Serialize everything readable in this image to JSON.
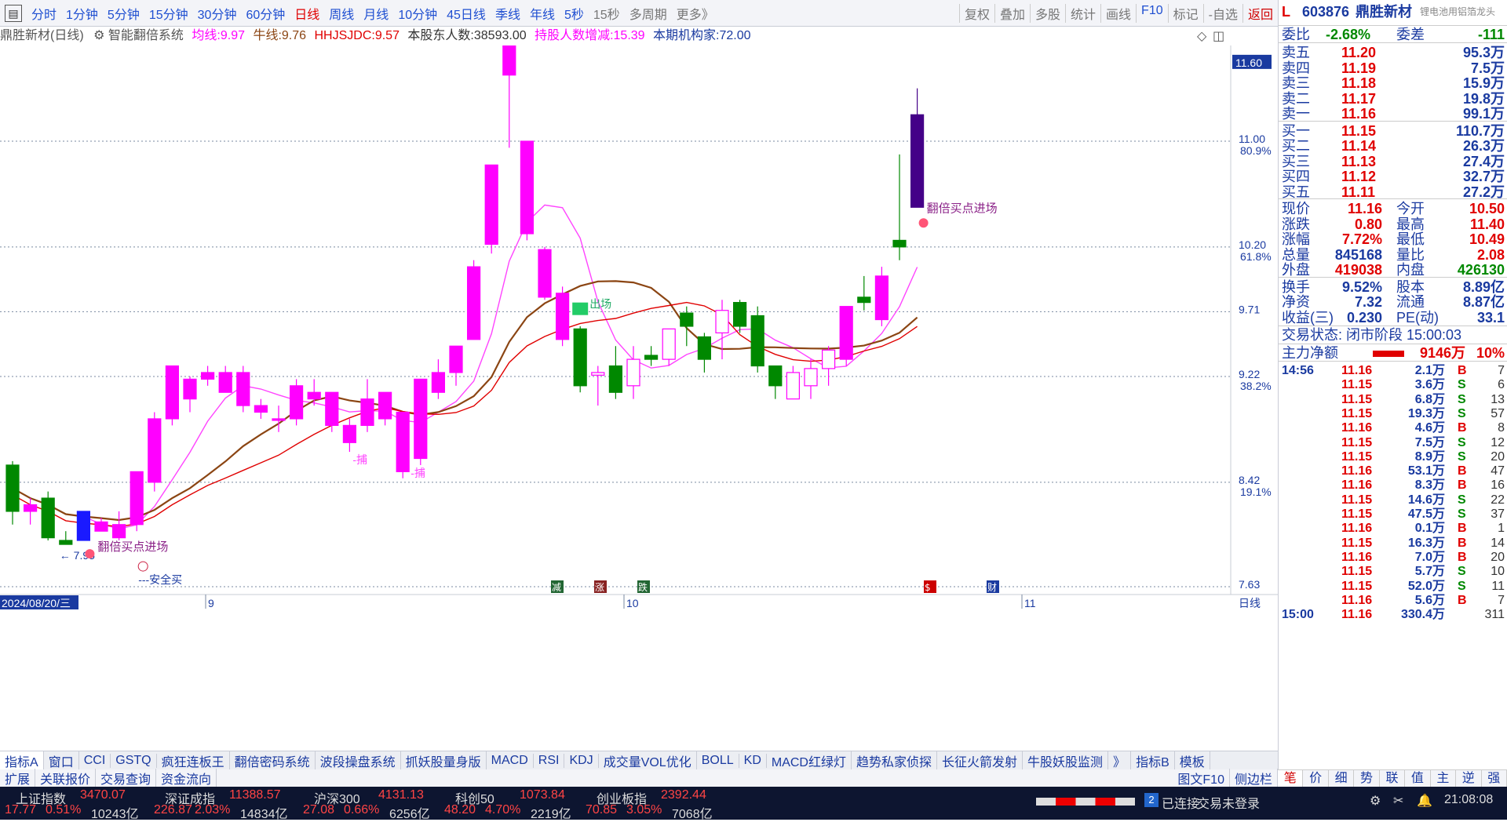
{
  "periods": [
    "分时",
    "1分钟",
    "5分钟",
    "15分钟",
    "30分钟",
    "60分钟",
    "日线",
    "周线",
    "月线",
    "10分钟",
    "45日线",
    "季线",
    "年线",
    "5秒",
    "15秒",
    "多周期",
    "更多》"
  ],
  "active_period": "日线",
  "tools": [
    "复权",
    "叠加",
    "多股",
    "统计",
    "画线",
    "F10",
    "标记",
    "-自选",
    "返回"
  ],
  "indicator_row": {
    "stock": "鼎胜新材(日线)",
    "system": "智能翻倍系统",
    "junxian_label": "均线:",
    "junxian": "9.97",
    "niuxian_label": "牛线:",
    "niuxian": "9.76",
    "hhjs_label": "HHJSJDC:",
    "hhjs": "9.57",
    "holders_label": "本股东人数:",
    "holders": "38593.00",
    "holders_chg_label": "持股人数增减:",
    "holders_chg": "15.39",
    "inst_label": "本期机构家:",
    "inst": "72.00"
  },
  "y_axis": {
    "ticks": [
      {
        "price": "11.60",
        "pct": ""
      },
      {
        "price": "11.00",
        "pct": "80.9%"
      },
      {
        "price": "10.20",
        "pct": "61.8%"
      },
      {
        "price": "9.71",
        "pct": ""
      },
      {
        "price": "9.22",
        "pct": "38.2%"
      },
      {
        "price": "8.42",
        "pct": "19.1%"
      },
      {
        "price": "7.63",
        "pct": ""
      }
    ],
    "highlight": "11.60"
  },
  "chart_data": {
    "type": "candlestick",
    "price_range": [
      7.6,
      11.9
    ],
    "candles": [
      {
        "o": 8.2,
        "c": 8.55,
        "h": 8.58,
        "l": 8.1,
        "up": false
      },
      {
        "o": 8.2,
        "c": 8.25,
        "h": 8.3,
        "l": 8.1,
        "up": true
      },
      {
        "o": 8.3,
        "c": 8.0,
        "h": 8.35,
        "l": 7.98,
        "up": false
      },
      {
        "o": 7.95,
        "c": 7.98,
        "h": 8.05,
        "l": 7.95,
        "up": false
      },
      {
        "o": 7.98,
        "c": 8.2,
        "h": 8.2,
        "l": 7.98,
        "up": false,
        "blue": true
      },
      {
        "o": 8.05,
        "c": 8.12,
        "h": 8.15,
        "l": 8.05,
        "up": true
      },
      {
        "o": 8.1,
        "c": 8.0,
        "h": 8.2,
        "l": 7.98,
        "up": true
      },
      {
        "o": 8.1,
        "c": 8.5,
        "h": 8.5,
        "l": 8.05,
        "up": true
      },
      {
        "o": 8.42,
        "c": 8.9,
        "h": 8.95,
        "l": 8.35,
        "up": true
      },
      {
        "o": 8.9,
        "c": 9.3,
        "h": 9.3,
        "l": 8.85,
        "up": true
      },
      {
        "o": 9.05,
        "c": 9.2,
        "h": 9.22,
        "l": 8.95,
        "up": true
      },
      {
        "o": 9.2,
        "c": 9.25,
        "h": 9.3,
        "l": 9.15,
        "up": true
      },
      {
        "o": 9.1,
        "c": 9.25,
        "h": 9.3,
        "l": 9.1,
        "up": true
      },
      {
        "o": 9.25,
        "c": 9.0,
        "h": 9.3,
        "l": 8.95,
        "up": false,
        "pink": true
      },
      {
        "o": 9.0,
        "c": 8.95,
        "h": 9.05,
        "l": 8.9,
        "up": true
      },
      {
        "o": 8.9,
        "c": 8.9,
        "h": 9.0,
        "l": 8.8,
        "up": true
      },
      {
        "o": 8.9,
        "c": 9.15,
        "h": 9.2,
        "l": 8.85,
        "up": true
      },
      {
        "o": 9.05,
        "c": 9.1,
        "h": 9.2,
        "l": 9.0,
        "up": true
      },
      {
        "o": 9.1,
        "c": 8.85,
        "h": 9.1,
        "l": 8.8,
        "up": false,
        "pink": true
      },
      {
        "o": 8.85,
        "c": 8.72,
        "h": 8.9,
        "l": 8.65,
        "up": false,
        "pink": true
      },
      {
        "o": 8.85,
        "c": 9.05,
        "h": 9.2,
        "l": 8.8,
        "up": true
      },
      {
        "o": 8.9,
        "c": 9.1,
        "h": 9.1,
        "l": 8.85,
        "up": true
      },
      {
        "o": 8.95,
        "c": 8.5,
        "h": 8.95,
        "l": 8.45,
        "up": false,
        "pink": true
      },
      {
        "o": 8.6,
        "c": 9.2,
        "h": 9.2,
        "l": 8.55,
        "up": true
      },
      {
        "o": 9.1,
        "c": 9.25,
        "h": 9.35,
        "l": 9.05,
        "up": true
      },
      {
        "o": 9.25,
        "c": 9.45,
        "h": 9.45,
        "l": 9.15,
        "up": true
      },
      {
        "o": 9.5,
        "c": 10.05,
        "h": 10.1,
        "l": 9.5,
        "up": true
      },
      {
        "o": 10.22,
        "c": 10.82,
        "h": 10.82,
        "l": 10.15,
        "up": true
      },
      {
        "o": 11.5,
        "c": 11.78,
        "h": 11.78,
        "l": 10.95,
        "up": true
      },
      {
        "o": 10.3,
        "c": 11.0,
        "h": 11.0,
        "l": 10.25,
        "up": true
      },
      {
        "o": 10.18,
        "c": 9.82,
        "h": 10.2,
        "l": 9.8,
        "up": false,
        "pink": true
      },
      {
        "o": 9.85,
        "c": 9.5,
        "h": 9.9,
        "l": 9.45,
        "up": false,
        "pink": true
      },
      {
        "o": 9.58,
        "c": 9.15,
        "h": 9.6,
        "l": 9.1,
        "up": false
      },
      {
        "o": 9.25,
        "c": 9.23,
        "h": 9.3,
        "l": 9.0,
        "up": true
      },
      {
        "o": 9.3,
        "c": 9.1,
        "h": 9.45,
        "l": 9.05,
        "up": false
      },
      {
        "o": 9.35,
        "c": 9.15,
        "h": 9.45,
        "l": 9.05,
        "up": true
      },
      {
        "o": 9.38,
        "c": 9.35,
        "h": 9.45,
        "l": 9.3,
        "up": false
      },
      {
        "o": 9.35,
        "c": 9.58,
        "h": 9.58,
        "l": 9.3,
        "up": true
      },
      {
        "o": 9.7,
        "c": 9.6,
        "h": 9.75,
        "l": 9.45,
        "up": false
      },
      {
        "o": 9.52,
        "c": 9.35,
        "h": 9.55,
        "l": 9.25,
        "up": false
      },
      {
        "o": 9.55,
        "c": 9.72,
        "h": 9.8,
        "l": 9.35,
        "up": true
      },
      {
        "o": 9.78,
        "c": 9.6,
        "h": 9.8,
        "l": 9.55,
        "up": false
      },
      {
        "o": 9.68,
        "c": 9.3,
        "h": 9.75,
        "l": 9.25,
        "up": false
      },
      {
        "o": 9.3,
        "c": 9.15,
        "h": 9.3,
        "l": 9.05,
        "up": false
      },
      {
        "o": 9.05,
        "c": 9.25,
        "h": 9.3,
        "l": 9.05,
        "up": true
      },
      {
        "o": 9.15,
        "c": 9.28,
        "h": 9.35,
        "l": 9.05,
        "up": true
      },
      {
        "o": 9.28,
        "c": 9.42,
        "h": 9.45,
        "l": 9.15,
        "up": true
      },
      {
        "o": 9.35,
        "c": 9.75,
        "h": 9.75,
        "l": 9.3,
        "up": true
      },
      {
        "o": 9.78,
        "c": 9.82,
        "h": 9.98,
        "l": 9.72,
        "up": false
      },
      {
        "o": 9.65,
        "c": 9.98,
        "h": 10.05,
        "l": 9.6,
        "up": true
      },
      {
        "o": 10.2,
        "c": 10.25,
        "h": 10.9,
        "l": 10.1,
        "up": false,
        "green": true
      },
      {
        "o": 11.2,
        "c": 10.5,
        "h": 11.4,
        "l": 10.5,
        "up": false,
        "purple": true
      }
    ],
    "date_labels": [
      "2024/08/20/三",
      "9",
      "10",
      "11"
    ],
    "annotations": {
      "high_label": "11.78",
      "low_label": "7.95",
      "buy_signal": "翻倍买点进场",
      "buy_signal_2": "翻倍买点进场",
      "safe_buy": "---安全买",
      "catch_1": "捕",
      "catch_2": "捕",
      "exit": "出场"
    },
    "event_markers": [
      "减",
      "涨",
      "跌",
      "$",
      "财"
    ]
  },
  "indicator_tabs": [
    "指标A",
    "窗口",
    "CCI",
    "GSTQ",
    "疯狂连板王",
    "翻倍密码系统",
    "波段操盘系统",
    "抓妖股量身版",
    "MACD",
    "RSI",
    "KDJ",
    "成交量VOL优化",
    "BOLL",
    "KD",
    "MACD红绿灯",
    "趋势私家侦探",
    "长征火箭发射",
    "牛股妖股监测",
    "》",
    "指标B",
    "模板"
  ],
  "bottom_tabs": [
    "扩展",
    "关联报价",
    "交易查询",
    "资金流向"
  ],
  "right_tabs": [
    "笔",
    "价",
    "细",
    "势",
    "联",
    "值",
    "主",
    "逆",
    "强"
  ],
  "stock_header": {
    "code": "603876",
    "name": "鼎胜新材",
    "tag": "锂电池用铝箔龙头",
    "badge": "L"
  },
  "weibi": {
    "label": "委比",
    "value": "-2.68%",
    "label2": "委差",
    "value2": "-111"
  },
  "asks": [
    {
      "label": "卖五",
      "price": "11.20",
      "vol": "95.3万"
    },
    {
      "label": "卖四",
      "price": "11.19",
      "vol": "7.5万"
    },
    {
      "label": "卖三",
      "price": "11.18",
      "vol": "15.9万"
    },
    {
      "label": "卖二",
      "price": "11.17",
      "vol": "19.8万"
    },
    {
      "label": "卖一",
      "price": "11.16",
      "vol": "99.1万"
    }
  ],
  "bids": [
    {
      "label": "买一",
      "price": "11.15",
      "vol": "110.7万"
    },
    {
      "label": "买二",
      "price": "11.14",
      "vol": "26.3万"
    },
    {
      "label": "买三",
      "price": "11.13",
      "vol": "27.4万"
    },
    {
      "label": "买四",
      "price": "11.12",
      "vol": "32.7万"
    },
    {
      "label": "买五",
      "price": "11.11",
      "vol": "27.2万"
    }
  ],
  "quote": [
    {
      "l1": "现价",
      "v1": "11.16",
      "c1": "red",
      "l2": "今开",
      "v2": "10.50",
      "c2": "red"
    },
    {
      "l1": "涨跌",
      "v1": "0.80",
      "c1": "red",
      "l2": "最高",
      "v2": "11.40",
      "c2": "red"
    },
    {
      "l1": "涨幅",
      "v1": "7.72%",
      "c1": "red",
      "l2": "最低",
      "v2": "10.49",
      "c2": "red"
    },
    {
      "l1": "总量",
      "v1": "845168",
      "c1": "navy",
      "l2": "量比",
      "v2": "2.08",
      "c2": "red"
    },
    {
      "l1": "外盘",
      "v1": "419038",
      "c1": "red",
      "l2": "内盘",
      "v2": "426130",
      "c2": "green"
    }
  ],
  "fund": [
    {
      "l1": "换手",
      "v1": "9.52%",
      "l2": "股本",
      "v2": "8.89亿"
    },
    {
      "l1": "净资",
      "v1": "7.32",
      "l2": "流通",
      "v2": "8.87亿"
    },
    {
      "l1": "收益(三)",
      "v1": "0.230",
      "l2": "PE(动)",
      "v2": "33.1"
    }
  ],
  "trade_status": "交易状态: 闭市阶段 15:00:03",
  "main_flow": {
    "label": "主力净额",
    "value": "9146万",
    "pct": "10%"
  },
  "ticks": [
    {
      "t": "14:56",
      "p": "11.16",
      "v": "2.1万",
      "d": "B",
      "n": "7"
    },
    {
      "t": "",
      "p": "11.15",
      "v": "3.6万",
      "d": "S",
      "n": "6"
    },
    {
      "t": "",
      "p": "11.15",
      "v": "6.8万",
      "d": "S",
      "n": "13"
    },
    {
      "t": "",
      "p": "11.15",
      "v": "19.3万",
      "d": "S",
      "n": "57"
    },
    {
      "t": "",
      "p": "11.16",
      "v": "4.6万",
      "d": "B",
      "n": "8"
    },
    {
      "t": "",
      "p": "11.15",
      "v": "7.5万",
      "d": "S",
      "n": "12"
    },
    {
      "t": "",
      "p": "11.15",
      "v": "8.9万",
      "d": "S",
      "n": "20"
    },
    {
      "t": "",
      "p": "11.16",
      "v": "53.1万",
      "d": "B",
      "n": "47"
    },
    {
      "t": "",
      "p": "11.16",
      "v": "8.3万",
      "d": "B",
      "n": "16"
    },
    {
      "t": "",
      "p": "11.15",
      "v": "14.6万",
      "d": "S",
      "n": "22"
    },
    {
      "t": "",
      "p": "11.15",
      "v": "47.5万",
      "d": "S",
      "n": "37"
    },
    {
      "t": "",
      "p": "11.16",
      "v": "0.1万",
      "d": "B",
      "n": "1"
    },
    {
      "t": "",
      "p": "11.15",
      "v": "16.3万",
      "d": "B",
      "n": "14"
    },
    {
      "t": "",
      "p": "11.16",
      "v": "7.0万",
      "d": "B",
      "n": "20"
    },
    {
      "t": "",
      "p": "11.15",
      "v": "5.7万",
      "d": "S",
      "n": "10"
    },
    {
      "t": "",
      "p": "11.15",
      "v": "52.0万",
      "d": "S",
      "n": "11"
    },
    {
      "t": "",
      "p": "11.16",
      "v": "5.6万",
      "d": "B",
      "n": "7"
    },
    {
      "t": "15:00",
      "p": "11.16",
      "v": "330.4万",
      "d": "",
      "n": "311"
    }
  ],
  "chart_extra": {
    "period_label": "日线",
    "sidebar_label": "图文F10",
    "sidebar_label2": "侧边栏"
  },
  "indices": [
    {
      "name": "上证指数",
      "value": "3470.07",
      "chg": "17.77",
      "pct": "0.51%",
      "amt": "10243亿"
    },
    {
      "name": "深证成指",
      "value": "11388.57",
      "chg": "226.87",
      "pct": "2.03%",
      "amt": "14834亿"
    },
    {
      "name": "沪深300",
      "value": "4131.13",
      "chg": "27.08",
      "pct": "0.66%",
      "amt": "6256亿"
    },
    {
      "name": "科创50",
      "value": "1073.84",
      "chg": "48.20",
      "pct": "4.70%",
      "amt": "2219亿"
    },
    {
      "name": "创业板指",
      "value": "2392.44",
      "chg": "70.85",
      "pct": "3.05%",
      "amt": "7068亿"
    }
  ],
  "status": {
    "conn_num": "2",
    "conn": "已连接",
    "trade": "交易未登录",
    "time": "21:08:08"
  }
}
